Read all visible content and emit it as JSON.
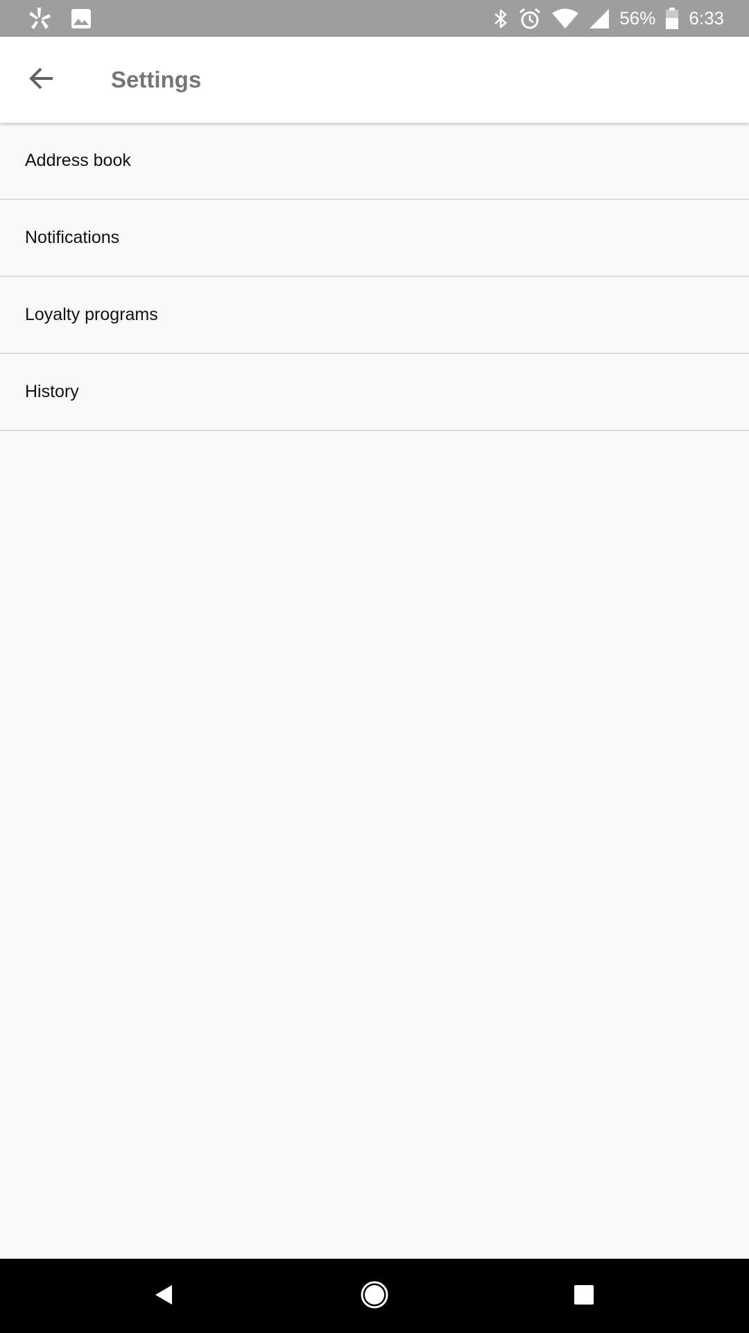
{
  "status_bar": {
    "battery_percent": "56%",
    "time": "6:33",
    "left_icons": [
      "yelp-icon",
      "image-icon"
    ],
    "right_icons": [
      "bluetooth-icon",
      "alarm-icon",
      "wifi-icon",
      "signal-icon",
      "battery-icon"
    ]
  },
  "app_bar": {
    "title": "Settings",
    "back_icon": "arrow-back-icon"
  },
  "settings": {
    "items": [
      {
        "label": "Address book"
      },
      {
        "label": "Notifications"
      },
      {
        "label": "Loyalty programs"
      },
      {
        "label": "History"
      }
    ]
  },
  "nav_bar": {
    "buttons": [
      "back-triangle-icon",
      "home-circle-icon",
      "recents-square-icon"
    ]
  },
  "colors": {
    "status_bar": "#9e9e9e",
    "app_bar": "#ffffff",
    "title_text": "#757575",
    "background": "#f9f9f9",
    "divider": "#dcdcdc",
    "nav_bar": "#000000"
  }
}
